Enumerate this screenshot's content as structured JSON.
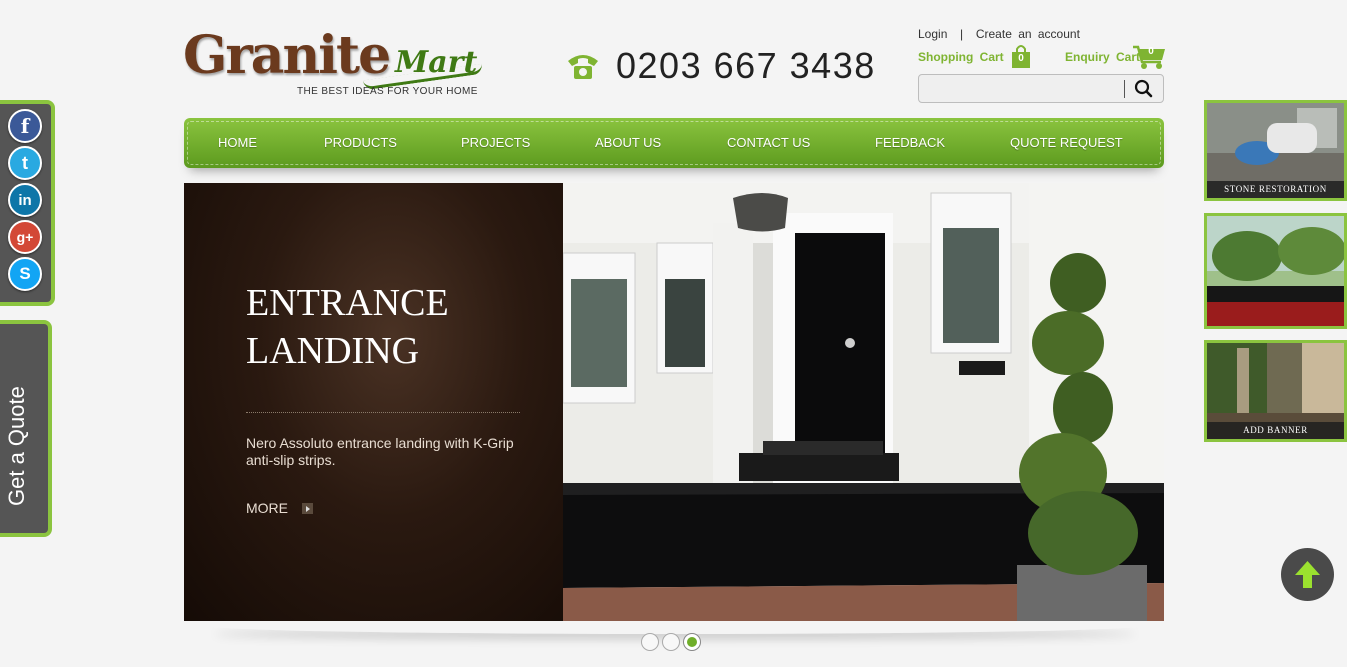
{
  "logo": {
    "brand_main": "Granite",
    "brand_accent": "Mart",
    "tagline": "THE BEST IDEAS FOR YOUR HOME"
  },
  "phone": {
    "number": "0203 667 3438",
    "icon": "phone-icon"
  },
  "account": {
    "login": "Login",
    "separator": "|",
    "create": "Create an account"
  },
  "carts": {
    "shopping_label": "Shopping Cart",
    "shopping_count": "0",
    "enquiry_label": "Enquiry Cart",
    "enquiry_count": "0"
  },
  "search": {
    "placeholder": "",
    "value": "",
    "icon": "search-icon"
  },
  "nav": {
    "items": [
      "HOME",
      "PRODUCTS",
      "PROJECTS",
      "ABOUT US",
      "CONTACT US",
      "FEEDBACK",
      "QUOTE REQUEST"
    ]
  },
  "hero": {
    "title": "ENTRANCE LANDING",
    "description": "Nero Assoluto entrance landing with K-Grip anti-slip strips.",
    "more_label": "MORE"
  },
  "slider": {
    "slide_count": 3,
    "active_index": 2
  },
  "social": {
    "icons": [
      "facebook-icon",
      "twitter-icon",
      "linkedin-icon",
      "google-plus-icon",
      "skype-icon"
    ],
    "labels": [
      "f",
      "t",
      "in",
      "g+",
      "S"
    ]
  },
  "quote_tab": {
    "label": "Get a Quote"
  },
  "side_banners": [
    {
      "label": "STONE RESTORATION"
    },
    {
      "label": ""
    },
    {
      "label": "ADD BANNER"
    }
  ],
  "colors": {
    "accent_green": "#7fb432",
    "nav_green": "#6fae2a",
    "brand_brown": "#6b3a1e",
    "hero_panel": "#2a1910"
  }
}
